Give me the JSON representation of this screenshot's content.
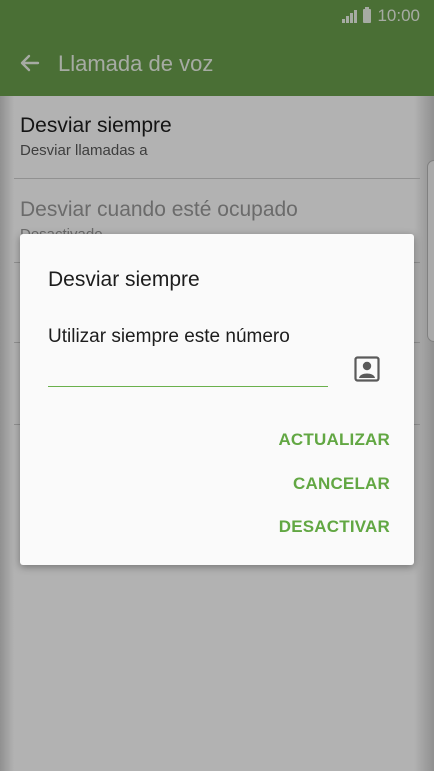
{
  "status_bar": {
    "time": "10:00",
    "signal_icon": "signal-icon",
    "battery_icon": "battery-icon"
  },
  "app_bar": {
    "title": "Llamada de voz",
    "back_icon": "arrow-back-icon"
  },
  "settings_list": {
    "items": [
      {
        "title": "Desviar siempre",
        "subtitle": "Desviar llamadas a"
      },
      {
        "title": "Desviar cuando esté ocupado",
        "subtitle": "Desactivado"
      }
    ]
  },
  "dialog": {
    "title": "Desviar siempre",
    "label": "Utilizar siempre este número",
    "input_value": "",
    "contact_icon": "contact-icon",
    "buttons": {
      "update": "ACTUALIZAR",
      "cancel": "CANCELAR",
      "deactivate": "DESACTIVAR"
    }
  },
  "colors": {
    "accent": "#6a9f4c",
    "button_text": "#62a743",
    "input_line": "#6ab04c"
  }
}
